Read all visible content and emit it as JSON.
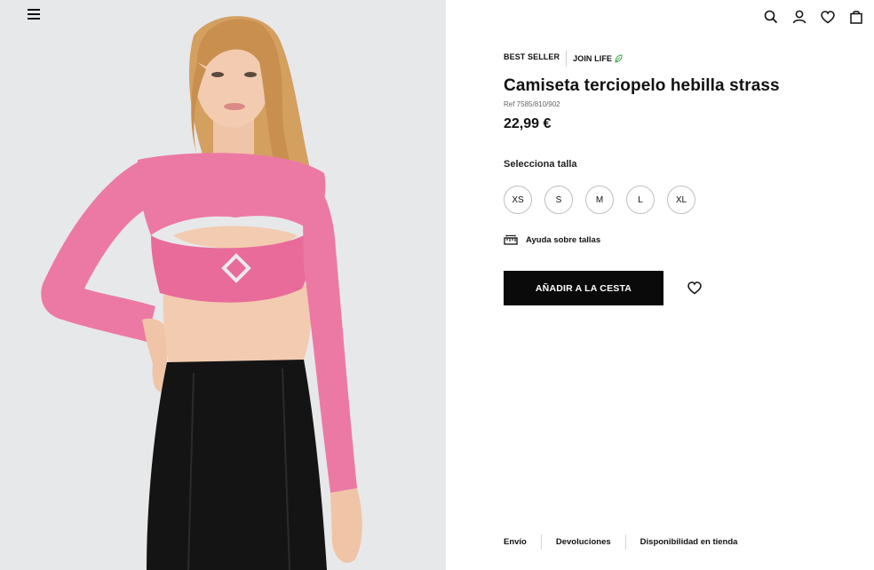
{
  "header": {
    "menu_icon": "hamburger-menu-icon",
    "icons": [
      "search-icon",
      "user-icon",
      "heart-icon",
      "bag-icon"
    ]
  },
  "product": {
    "badge_best_seller": "BEST SELLER",
    "badge_join_life": "JOIN LIFE",
    "title": "Camiseta terciopelo hebilla strass",
    "ref": "Ref 7585/810/902",
    "price": "22,99 €",
    "size_label": "Selecciona talla",
    "sizes": [
      "XS",
      "S",
      "M",
      "L",
      "XL"
    ],
    "size_help": "Ayuda sobre tallas",
    "add_to_cart": "AÑADIR A LA CESTA"
  },
  "footer": {
    "links": [
      "Envío",
      "Devoluciones",
      "Disponibilidad en tienda"
    ]
  },
  "colors": {
    "accent": "#0a0a0a",
    "photo_background": "#e7e8ea",
    "top_color": "#ec79a4",
    "leaf_green": "#3aa14a"
  }
}
